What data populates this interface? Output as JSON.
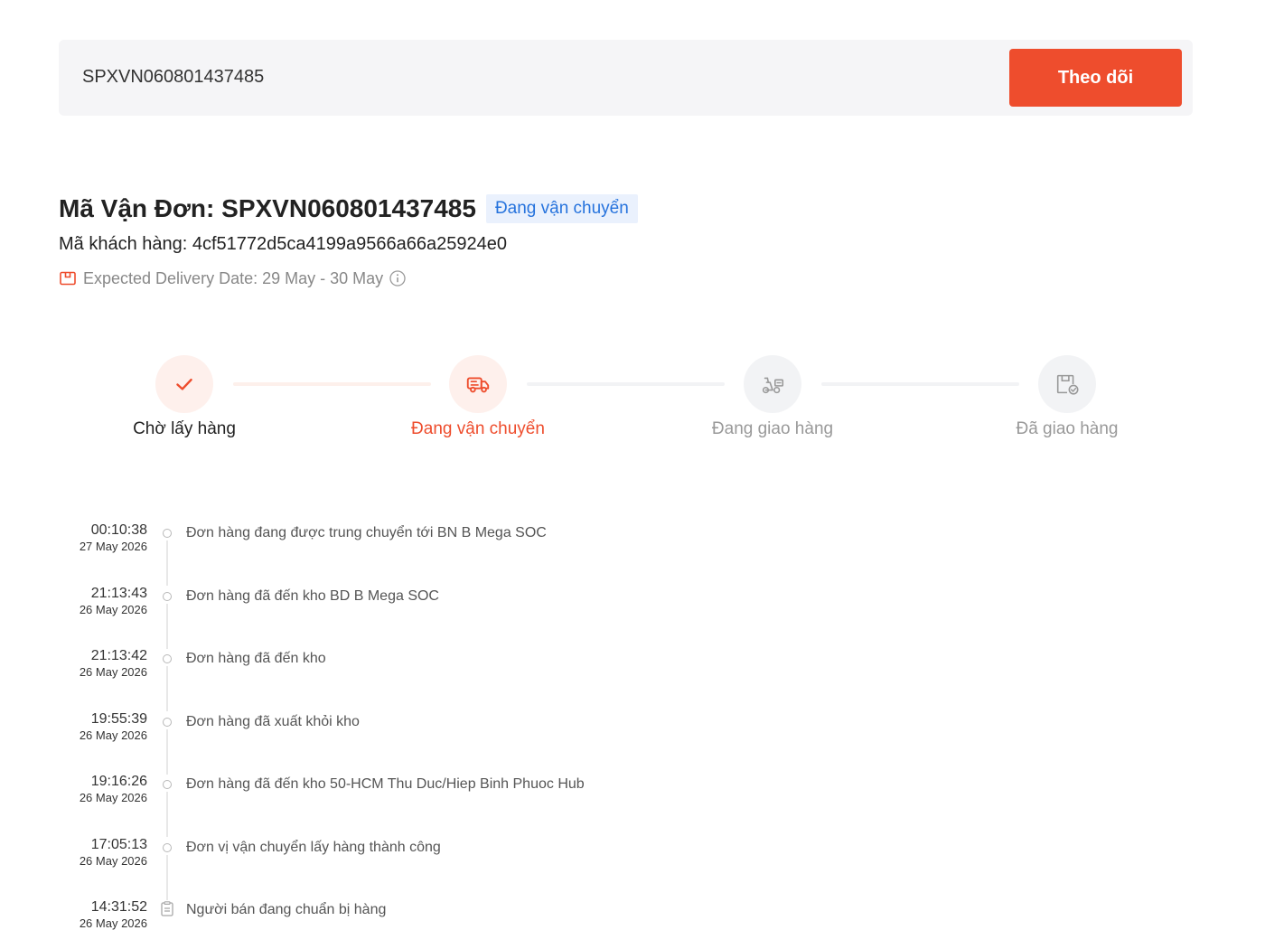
{
  "theme": {
    "accent": "#ee4d2d",
    "badge_text": "#2673dd",
    "badge_bg": "#eaf1fd",
    "muted": "#999999"
  },
  "search": {
    "value": "SPXVN060801437485",
    "button_label": "Theo dõi"
  },
  "shipment": {
    "title": "Mã Vận Đơn: SPXVN060801437485",
    "status": "Đang vận chuyển",
    "customer_code": "Mã khách hàng: 4cf51772d5ca4199a9566a66a25924e0",
    "expected_delivery": "Expected Delivery Date: 29 May - 30 May",
    "expected_icon": "package-icon",
    "info_icon": "info-icon"
  },
  "steps": {
    "current_index": 1,
    "items": [
      {
        "label": "Chờ lấy hàng",
        "icon": "check-icon"
      },
      {
        "label": "Đang vận chuyển",
        "icon": "truck-icon"
      },
      {
        "label": "Đang giao hàng",
        "icon": "scooter-icon"
      },
      {
        "label": "Đã giao hàng",
        "icon": "box-check-icon"
      }
    ]
  },
  "timeline": [
    {
      "time": "00:10:38",
      "date": "27 May 2026",
      "description": "Đơn hàng đang được trung chuyển tới BN B Mega SOC",
      "icon": "circle-dot-icon"
    },
    {
      "time": "21:13:43",
      "date": "26 May 2026",
      "description": "Đơn hàng đã đến kho BD B Mega SOC",
      "icon": "circle-dot-icon"
    },
    {
      "time": "21:13:42",
      "date": "26 May 2026",
      "description": "Đơn hàng đã đến kho",
      "icon": "circle-dot-icon"
    },
    {
      "time": "19:55:39",
      "date": "26 May 2026",
      "description": "Đơn hàng đã xuất khỏi kho",
      "icon": "circle-dot-icon"
    },
    {
      "time": "19:16:26",
      "date": "26 May 2026",
      "description": "Đơn hàng đã đến kho 50-HCM Thu Duc/Hiep Binh Phuoc Hub",
      "icon": "circle-dot-icon"
    },
    {
      "time": "17:05:13",
      "date": "26 May 2026",
      "description": "Đơn vị vận chuyển lấy hàng thành công",
      "icon": "circle-dot-icon"
    },
    {
      "time": "14:31:52",
      "date": "26 May 2026",
      "description": "Người bán đang chuẩn bị hàng",
      "icon": "clipboard-icon"
    }
  ]
}
